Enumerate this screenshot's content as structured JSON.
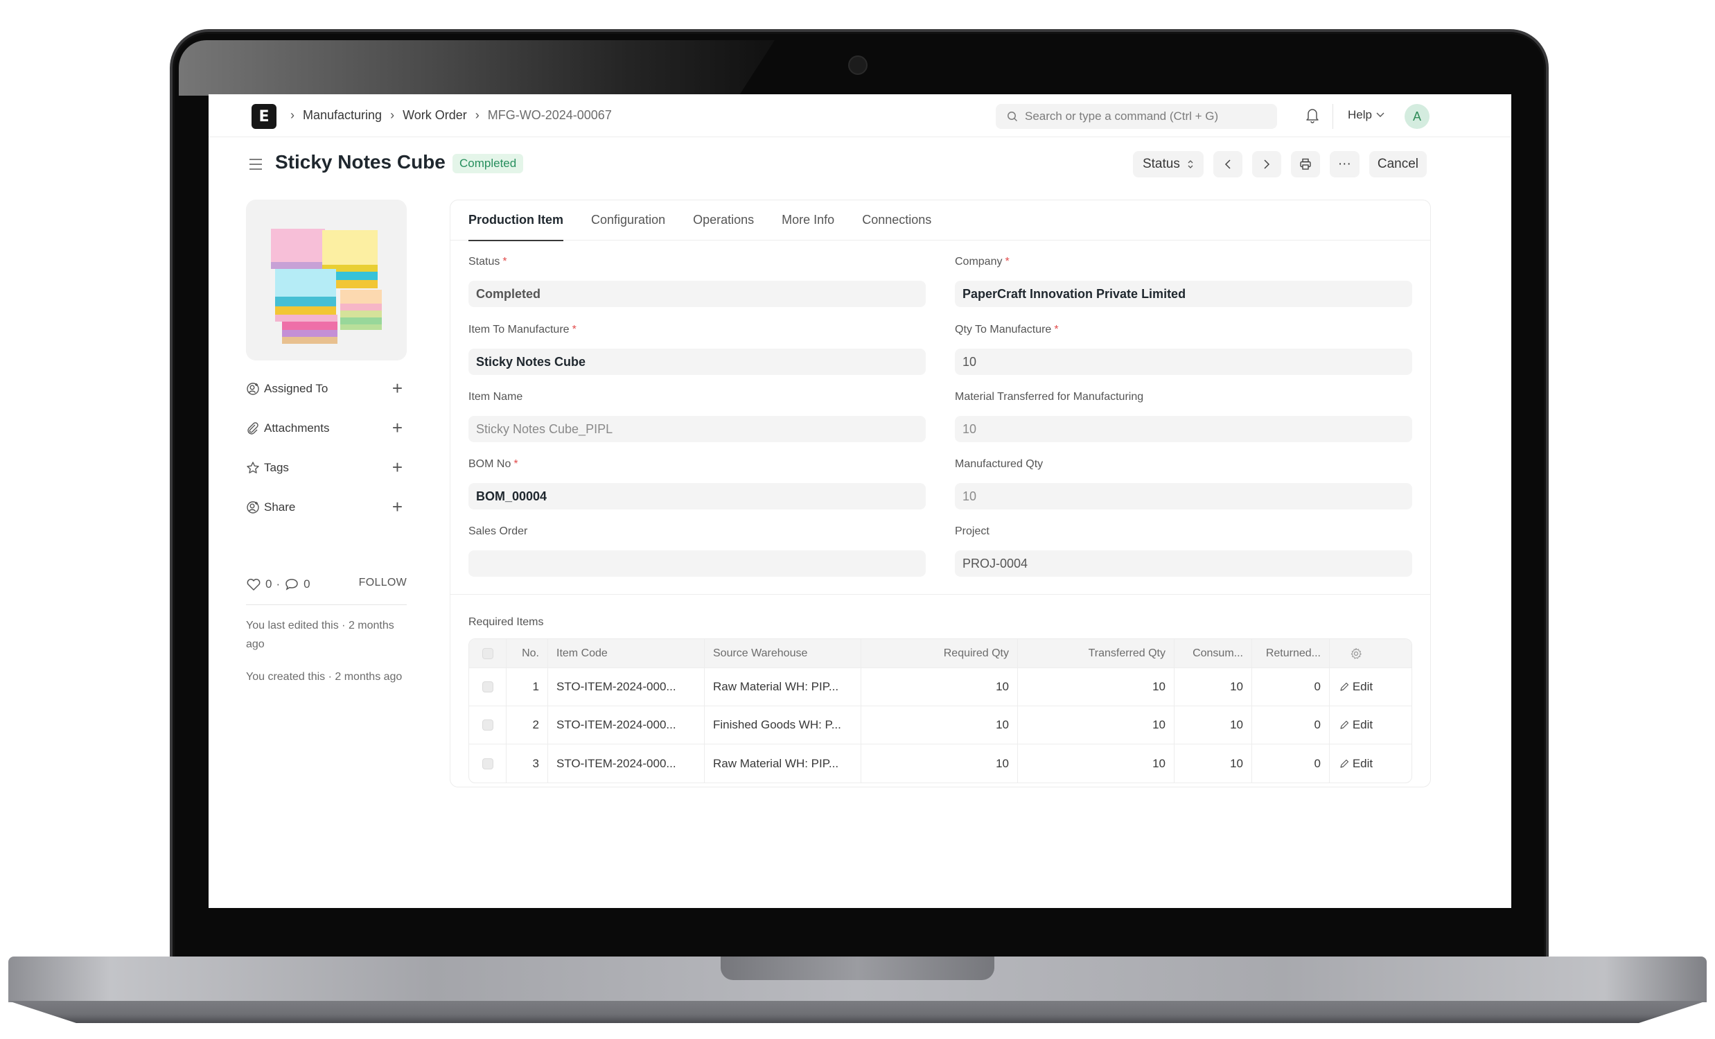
{
  "navbar": {
    "logo_letter": "E",
    "breadcrumbs": [
      "Manufacturing",
      "Work Order",
      "MFG-WO-2024-00067"
    ],
    "search_placeholder": "Search or type a command (Ctrl + G)",
    "help_label": "Help",
    "avatar_initial": "A"
  },
  "header": {
    "title": "Sticky Notes Cube",
    "status_badge": "Completed",
    "status_button": "Status",
    "cancel_button": "Cancel",
    "more_label": "···"
  },
  "sidebar": {
    "items": [
      {
        "label": "Assigned To",
        "icon": "assign-user-icon"
      },
      {
        "label": "Attachments",
        "icon": "paperclip-icon"
      },
      {
        "label": "Tags",
        "icon": "star-icon"
      },
      {
        "label": "Share",
        "icon": "share-user-icon"
      }
    ],
    "likes": "0",
    "comments": "0",
    "dot": "·",
    "follow_label": "FOLLOW",
    "last_edited": "You last edited this · 2 months ago",
    "created": "You created this · 2 months ago"
  },
  "tabs": [
    "Production Item",
    "Configuration",
    "Operations",
    "More Info",
    "Connections"
  ],
  "active_tab": "Production Item",
  "form": {
    "status": {
      "label": "Status",
      "required": true,
      "value": "Completed"
    },
    "company": {
      "label": "Company",
      "required": true,
      "value": "PaperCraft Innovation Private Limited"
    },
    "item_to_manufacture": {
      "label": "Item To Manufacture",
      "required": true,
      "value": "Sticky Notes Cube"
    },
    "qty_to_manufacture": {
      "label": "Qty To Manufacture",
      "required": true,
      "value": "10"
    },
    "item_name": {
      "label": "Item Name",
      "required": false,
      "value": "Sticky Notes Cube_PIPL"
    },
    "material_transferred": {
      "label": "Material Transferred for Manufacturing",
      "required": false,
      "value": "10"
    },
    "bom_no": {
      "label": "BOM No",
      "required": true,
      "value": "BOM_00004"
    },
    "manufactured_qty": {
      "label": "Manufactured Qty",
      "required": false,
      "value": "10"
    },
    "sales_order": {
      "label": "Sales Order",
      "required": false,
      "value": ""
    },
    "project": {
      "label": "Project",
      "required": false,
      "value": "PROJ-0004"
    }
  },
  "required_items": {
    "label": "Required Items",
    "columns": [
      "No.",
      "Item Code",
      "Source Warehouse",
      "Required Qty",
      "Transferred Qty",
      "Consum...",
      "Returned..."
    ],
    "edit_label": "Edit",
    "rows": [
      {
        "no": "1",
        "item_code": "STO-ITEM-2024-000...",
        "source_warehouse": "Raw Material WH: PIP...",
        "required_qty": "10",
        "transferred_qty": "10",
        "consumed": "10",
        "returned": "0"
      },
      {
        "no": "2",
        "item_code": "STO-ITEM-2024-000...",
        "source_warehouse": "Finished Goods WH: P...",
        "required_qty": "10",
        "transferred_qty": "10",
        "consumed": "10",
        "returned": "0"
      },
      {
        "no": "3",
        "item_code": "STO-ITEM-2024-000...",
        "source_warehouse": "Raw Material WH: PIP...",
        "required_qty": "10",
        "transferred_qty": "10",
        "consumed": "10",
        "returned": "0"
      }
    ]
  },
  "colors": {
    "badge_bg": "#e4f5e9",
    "badge_text": "#278f5e",
    "required_star": "#e24c4c",
    "avatar_bg": "#d4ecdf"
  }
}
